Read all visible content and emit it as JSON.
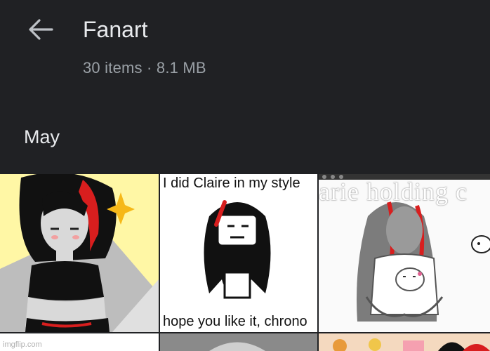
{
  "header": {
    "back_icon": "arrow-back-icon",
    "title": "Fanart",
    "item_count": "30 items",
    "separator": "·",
    "size": "8.1 MB",
    "subtitle": "30 items · 8.1 MB"
  },
  "section": {
    "label": "May"
  },
  "thumbnails": [
    {
      "caption_top": "",
      "caption_bottom": ""
    },
    {
      "caption_top": "I did Claire in my style",
      "caption_bottom": "hope you like it, chrono"
    },
    {
      "overlay_text": "arie holding c"
    }
  ],
  "watermark": "imgflip.com",
  "colors": {
    "background": "#202124",
    "title": "#e8eaed",
    "subtitle": "#9aa0a6",
    "hair_red": "#d81e1e",
    "tile1_bg": "#fff7a5"
  }
}
